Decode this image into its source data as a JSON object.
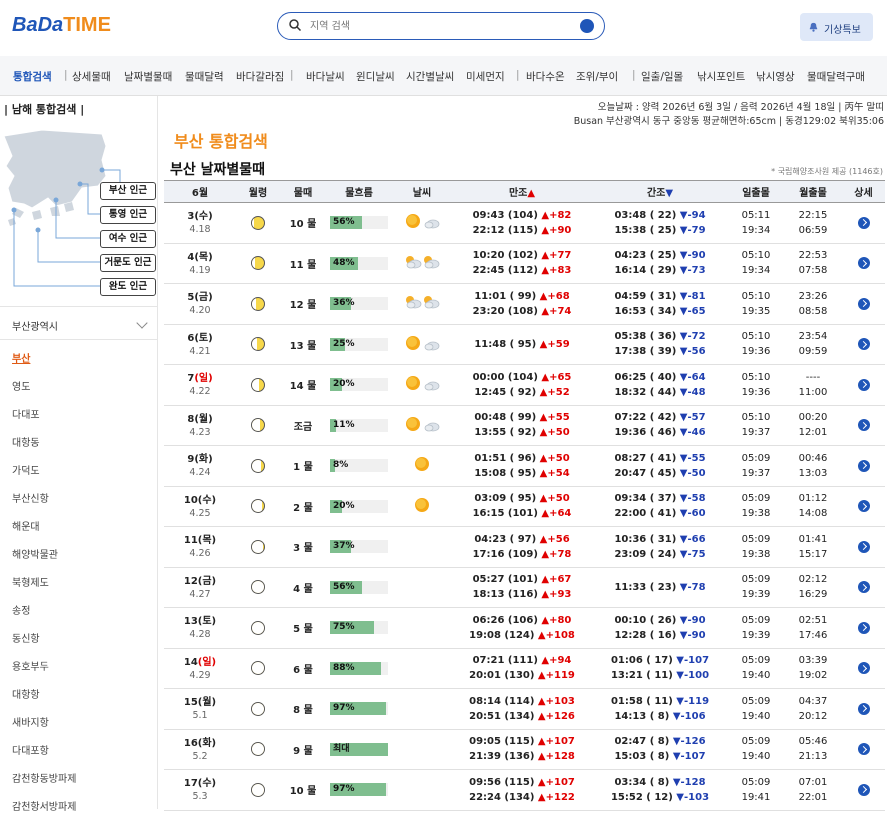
{
  "logo": {
    "part1": "BaDa",
    "part2": "TIME"
  },
  "search": {
    "placeholder": "지역 검색"
  },
  "warning_button": "기상특보",
  "nav": [
    "통합검색",
    "상세물때",
    "날짜별물때",
    "물때달력",
    "바다갈라짐",
    "바다날씨",
    "윈디날씨",
    "시간별날씨",
    "미세먼지",
    "바다수온",
    "조위/부이",
    "일출/일몰",
    "낚시포인트",
    "낚시영상",
    "물때달력구매"
  ],
  "sidebar": {
    "title": "| 남해 통합검색 |",
    "near_buttons": [
      "부산 인근",
      "통영 인근",
      "여수 인근",
      "거문도 인근",
      "완도 인근"
    ],
    "region": "부산광역시",
    "ports": [
      "부산",
      "영도",
      "다대포",
      "대항동",
      "가덕도",
      "부산신항",
      "해운대",
      "해양박물관",
      "북형제도",
      "송정",
      "동신항",
      "용호부두",
      "대항항",
      "새바지항",
      "다대포항",
      "감천항동방파제",
      "감천항서방파제"
    ]
  },
  "main": {
    "date_line": "오늘날짜 : 양력 2026년 6월 3일 / 음력 2026년 4월 18일 | 丙午 말띠",
    "loc_line": "Busan 부산광역시 동구 중앙동 평균해면하:65cm | 동경129:02 북위35:06",
    "title_orange": "부산 통합검색",
    "title_black": "부산 날짜별물때",
    "credit": "* 국립해양조사원 제공 (1146호)",
    "columns": [
      "6월",
      "월령",
      "물때",
      "물흐름",
      "날씨",
      "만조",
      "간조",
      "일출몰",
      "월출몰",
      "상세"
    ],
    "rows": [
      {
        "d": "3",
        "w": "(수)",
        "sun": false,
        "lunar": "4.18",
        "phase": 0.86,
        "mul": "10 물",
        "flow": 56,
        "flow_label": "56%",
        "wx": "sun-cloud",
        "h1": "09:43 (104)",
        "h1d": "+82",
        "h2": "22:12 (115)",
        "h2d": "+90",
        "l1": "03:48 ( 22)",
        "l1d": "-94",
        "l2": "15:38 ( 25)",
        "l2d": "-79",
        "sr": "05:11",
        "ss": "19:34",
        "mr": "22:15",
        "ms": "06:59"
      },
      {
        "d": "4",
        "w": "(목)",
        "sun": false,
        "lunar": "4.19",
        "phase": 0.78,
        "mul": "11 물",
        "flow": 48,
        "flow_label": "48%",
        "wx": "cloud-cloud",
        "h1": "10:20 (102)",
        "h1d": "+77",
        "h2": "22:45 (112)",
        "h2d": "+83",
        "l1": "04:23 ( 25)",
        "l1d": "-90",
        "l2": "16:14 ( 29)",
        "l2d": "-73",
        "sr": "05:10",
        "ss": "19:34",
        "mr": "22:53",
        "ms": "07:58"
      },
      {
        "d": "5",
        "w": "(금)",
        "sun": false,
        "lunar": "4.20",
        "phase": 0.7,
        "mul": "12 물",
        "flow": 36,
        "flow_label": "36%",
        "wx": "cloud-cloud",
        "h1": "11:01 ( 99)",
        "h1d": "+68",
        "h2": "23:20 (108)",
        "h2d": "+74",
        "l1": "04:59 ( 31)",
        "l1d": "-81",
        "l2": "16:53 ( 34)",
        "l2d": "-65",
        "sr": "05:10",
        "ss": "19:35",
        "mr": "23:26",
        "ms": "08:58"
      },
      {
        "d": "6",
        "w": "(토)",
        "sun": false,
        "lunar": "4.21",
        "phase": 0.62,
        "mul": "13 물",
        "flow": 25,
        "flow_label": "25%",
        "wx": "sun-cloud",
        "h1": "11:48 ( 95)",
        "h1d": "+59",
        "h2": "",
        "h2d": "",
        "l1": "05:38 ( 36)",
        "l1d": "-72",
        "l2": "17:38 ( 39)",
        "l2d": "-56",
        "sr": "05:10",
        "ss": "19:36",
        "mr": "23:54",
        "ms": "09:59"
      },
      {
        "d": "7",
        "w": "(일)",
        "sun": true,
        "lunar": "4.22",
        "phase": 0.5,
        "mul": "14 물",
        "flow": 20,
        "flow_label": "20%",
        "wx": "sun-cloud",
        "h1": "00:00 (104)",
        "h1d": "+65",
        "h2": "12:45 ( 92)",
        "h2d": "+52",
        "l1": "06:25 ( 40)",
        "l1d": "-64",
        "l2": "18:32 ( 44)",
        "l2d": "-48",
        "sr": "05:10",
        "ss": "19:36",
        "mr": "----",
        "ms": "11:00"
      },
      {
        "d": "8",
        "w": "(월)",
        "sun": false,
        "lunar": "4.23",
        "phase": 0.42,
        "mul": "조금",
        "flow": 11,
        "flow_label": "11%",
        "wx": "sun-cloud",
        "h1": "00:48 ( 99)",
        "h1d": "+55",
        "h2": "13:55 ( 92)",
        "h2d": "+50",
        "l1": "07:22 ( 42)",
        "l1d": "-57",
        "l2": "19:36 ( 46)",
        "l2d": "-46",
        "sr": "05:10",
        "ss": "19:37",
        "mr": "00:20",
        "ms": "12:01"
      },
      {
        "d": "9",
        "w": "(화)",
        "sun": false,
        "lunar": "4.24",
        "phase": 0.35,
        "mul": "1 물",
        "flow": 8,
        "flow_label": "8%",
        "wx": "sun",
        "h1": "01:51 ( 96)",
        "h1d": "+50",
        "h2": "15:08 ( 95)",
        "h2d": "+54",
        "l1": "08:27 ( 41)",
        "l1d": "-55",
        "l2": "20:47 ( 45)",
        "l2d": "-50",
        "sr": "05:09",
        "ss": "19:37",
        "mr": "00:46",
        "ms": "13:03"
      },
      {
        "d": "10",
        "w": "(수)",
        "sun": false,
        "lunar": "4.25",
        "phase": 0.28,
        "mul": "2 물",
        "flow": 20,
        "flow_label": "20%",
        "wx": "sun",
        "h1": "03:09 ( 95)",
        "h1d": "+50",
        "h2": "16:15 (101)",
        "h2d": "+64",
        "l1": "09:34 ( 37)",
        "l1d": "-58",
        "l2": "22:00 ( 41)",
        "l2d": "-60",
        "sr": "05:09",
        "ss": "19:38",
        "mr": "01:12",
        "ms": "14:08"
      },
      {
        "d": "11",
        "w": "(목)",
        "sun": false,
        "lunar": "4.26",
        "phase": 0.2,
        "mul": "3 물",
        "flow": 37,
        "flow_label": "37%",
        "wx": "",
        "h1": "04:23 ( 97)",
        "h1d": "+56",
        "h2": "17:16 (109)",
        "h2d": "+78",
        "l1": "10:36 ( 31)",
        "l1d": "-66",
        "l2": "23:09 ( 24)",
        "l2d": "-75",
        "sr": "05:09",
        "ss": "19:38",
        "mr": "01:41",
        "ms": "15:17"
      },
      {
        "d": "12",
        "w": "(금)",
        "sun": false,
        "lunar": "4.27",
        "phase": 0.14,
        "mul": "4 물",
        "flow": 56,
        "flow_label": "56%",
        "wx": "",
        "h1": "05:27 (101)",
        "h1d": "+67",
        "h2": "18:13 (116)",
        "h2d": "+93",
        "l1": "11:33 ( 23)",
        "l1d": "-78",
        "l2": "",
        "l2d": "",
        "sr": "05:09",
        "ss": "19:39",
        "mr": "02:12",
        "ms": "16:29"
      },
      {
        "d": "13",
        "w": "(토)",
        "sun": false,
        "lunar": "4.28",
        "phase": 0.08,
        "mul": "5 물",
        "flow": 75,
        "flow_label": "75%",
        "wx": "",
        "h1": "06:26 (106)",
        "h1d": "+80",
        "h2": "19:08 (124)",
        "h2d": "+108",
        "l1": "00:10 ( 26)",
        "l1d": "-90",
        "l2": "12:28 ( 16)",
        "l2d": "-90",
        "sr": "05:09",
        "ss": "19:39",
        "mr": "02:51",
        "ms": "17:46"
      },
      {
        "d": "14",
        "w": "(일)",
        "sun": true,
        "lunar": "4.29",
        "phase": 0.0,
        "mul": "6 물",
        "flow": 88,
        "flow_label": "88%",
        "wx": "",
        "h1": "07:21 (111)",
        "h1d": "+94",
        "h2": "20:01 (130)",
        "h2d": "+119",
        "l1": "01:06 ( 17)",
        "l1d": "-107",
        "l2": "13:21 ( 11)",
        "l2d": "-100",
        "sr": "05:09",
        "ss": "19:40",
        "mr": "03:39",
        "ms": "19:02"
      },
      {
        "d": "15",
        "w": "(월)",
        "sun": false,
        "lunar": "5.1",
        "phase": 0.03,
        "mul": "8 물",
        "flow": 97,
        "flow_label": "97%",
        "wx": "",
        "h1": "08:14 (114)",
        "h1d": "+103",
        "h2": "20:51 (134)",
        "h2d": "+126",
        "l1": "01:58 ( 11)",
        "l1d": "-119",
        "l2": "14:13 ( 8)",
        "l2d": "-106",
        "sr": "05:09",
        "ss": "19:40",
        "mr": "04:37",
        "ms": "20:12"
      },
      {
        "d": "16",
        "w": "(화)",
        "sun": false,
        "lunar": "5.2",
        "phase": 0.06,
        "mul": "9 물",
        "flow": 100,
        "flow_label": "최대",
        "wx": "",
        "h1": "09:05 (115)",
        "h1d": "+107",
        "h2": "21:39 (136)",
        "h2d": "+128",
        "l1": "02:47 ( 8)",
        "l1d": "-126",
        "l2": "15:03 ( 8)",
        "l2d": "-107",
        "sr": "05:09",
        "ss": "19:40",
        "mr": "05:46",
        "ms": "21:13"
      },
      {
        "d": "17",
        "w": "(수)",
        "sun": false,
        "lunar": "5.3",
        "phase": 0.1,
        "mul": "10 물",
        "flow": 97,
        "flow_label": "97%",
        "wx": "",
        "h1": "09:56 (115)",
        "h1d": "+107",
        "h2": "22:24 (134)",
        "h2d": "+122",
        "l1": "03:34 ( 8)",
        "l1d": "-128",
        "l2": "15:52 ( 12)",
        "l2d": "-103",
        "sr": "05:09",
        "ss": "19:41",
        "mr": "07:01",
        "ms": "22:01"
      }
    ]
  },
  "colors": {
    "brand_blue": "#1f56b8",
    "brand_orange": "#f08c1c",
    "flow_bar": "#7fbe8f",
    "up": "#e00000",
    "down": "#1f3fb0"
  }
}
